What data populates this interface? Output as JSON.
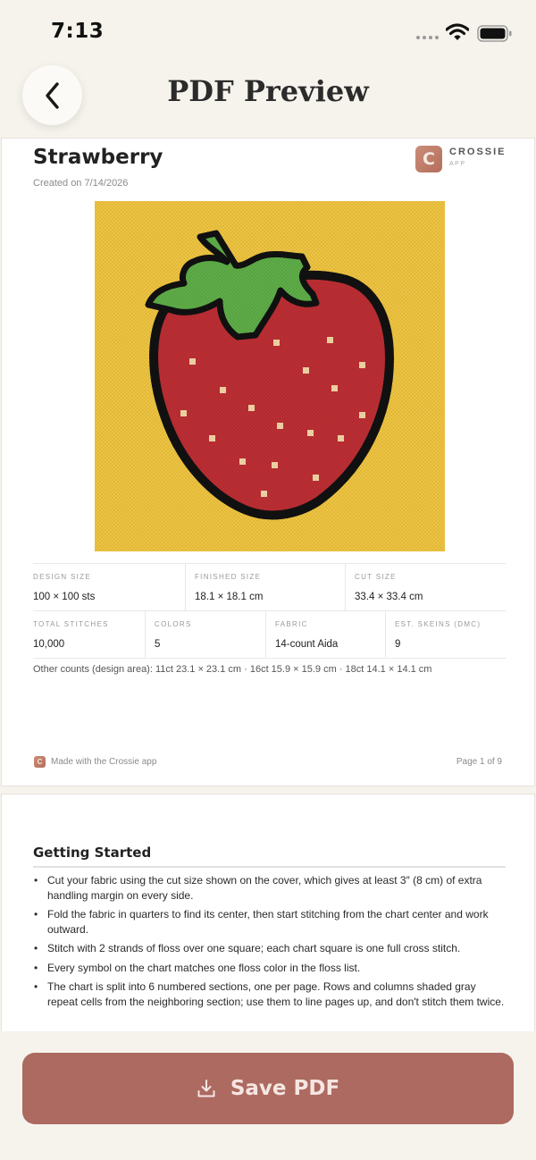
{
  "status_bar": {
    "time": "7:13"
  },
  "nav": {
    "title": "PDF Preview",
    "back_icon": "chevron-left-icon"
  },
  "cover": {
    "title": "Strawberry",
    "created": "Created on 7/14/2026",
    "brand": {
      "name": "CROSSIE",
      "sub": "APP",
      "logo_letter": "C"
    },
    "image": "strawberry-cross-stitch-pattern",
    "stats_row_1": [
      {
        "label": "DESIGN SIZE",
        "value": "100 × 100 sts"
      },
      {
        "label": "FINISHED SIZE",
        "value": "18.1 × 18.1 cm"
      },
      {
        "label": "CUT SIZE",
        "value": "33.4 × 33.4 cm"
      }
    ],
    "stats_row_2": [
      {
        "label": "TOTAL STITCHES",
        "value": "10,000"
      },
      {
        "label": "COLORS",
        "value": "5"
      },
      {
        "label": "FABRIC",
        "value": "14-count Aida"
      },
      {
        "label": "EST. SKEINS (DMC)",
        "value": "9"
      }
    ],
    "other_counts": "Other counts (design area): 11ct 23.1 × 23.1 cm · 16ct 15.9 × 15.9 cm · 18ct 14.1 × 14.1 cm",
    "footer": {
      "logo_letter": "C",
      "made_with": "Made with the Crossie app",
      "page": "Page 1 of 9"
    }
  },
  "page2": {
    "section_title": "Getting Started",
    "instructions": [
      "Cut your fabric using the cut size shown on the cover, which gives at least 3″ (8 cm) of extra handling margin on every side.",
      "Fold the fabric in quarters to find its center, then start stitching from the chart center and work outward.",
      "Stitch with 2 strands of floss over one square; each chart square is one full cross stitch.",
      "Every symbol on the chart matches one floss color in the floss list.",
      "The chart is split into 6 numbered sections, one per page. Rows and columns shaded gray repeat cells from the neighboring section; use them to line pages up, and don't stitch them twice."
    ]
  },
  "save_button": {
    "label": "Save PDF",
    "icon": "download-icon"
  },
  "colors": {
    "accent": "#ac6a61",
    "background": "#f6f3ec",
    "pattern_background": "#f0c541",
    "strawberry_red": "#bd2e34",
    "leaf_green": "#5fae48",
    "seed_cream": "#f5d6a6",
    "outline": "#111111"
  }
}
